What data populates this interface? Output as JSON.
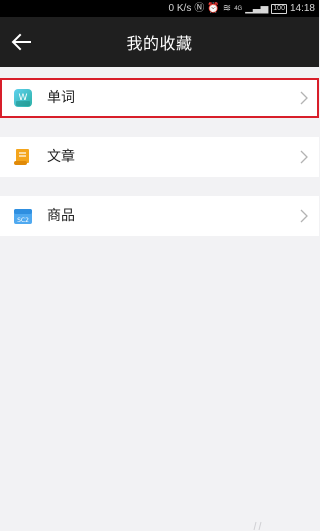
{
  "status_bar": {
    "speed": "0 K/s",
    "network": "4G",
    "battery": "100",
    "time": "14:18"
  },
  "header": {
    "title": "我的收藏",
    "back_icon": "arrow-left-icon"
  },
  "favorites": [
    {
      "label": "单词",
      "icon": "word-app-icon",
      "selected": true
    },
    {
      "label": "文章",
      "icon": "scroll-icon",
      "selected": false
    },
    {
      "label": "商品",
      "icon": "shop-icon",
      "selected": false
    }
  ],
  "colors": {
    "nav_background": "#1f1f1f",
    "page_background": "#f2f2f4",
    "selection_outline": "#d81e2a"
  }
}
